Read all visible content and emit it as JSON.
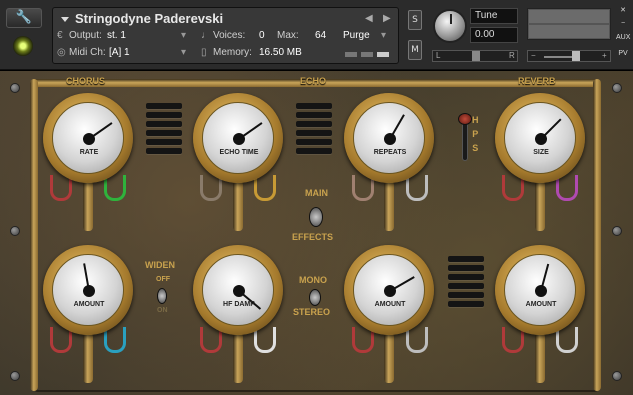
{
  "header": {
    "instrument_name": "Stringodyne Paderevski",
    "output_label": "Output:",
    "output_value": "st. 1",
    "voices_label": "Voices:",
    "voices_value": "0",
    "max_label": "Max:",
    "max_value": "64",
    "purge_label": "Purge",
    "midi_label": "Midi Ch:",
    "midi_value": "[A] 1",
    "memory_label": "Memory:",
    "memory_value": "16.50 MB",
    "s_label": "S",
    "m_label": "M",
    "tune_label": "Tune",
    "tune_value": "0.00",
    "pan_left": "L",
    "pan_right": "R",
    "vol_minus": "−",
    "vol_plus": "+",
    "side_close": "✕",
    "side_min": "−",
    "side_aux": "AUX",
    "side_pv": "PV"
  },
  "sections": {
    "chorus": "CHORUS",
    "echo": "ECHO",
    "reverb": "REVERB"
  },
  "gauges": {
    "rate": "RATE",
    "echo_time": "ECHO TIME",
    "repeats": "REPEATS",
    "size": "SIZE",
    "amount1": "AMOUNT",
    "hf_damp": "HF DAMP",
    "amount2": "AMOUNT",
    "amount3": "AMOUNT"
  },
  "switches": {
    "main": "MAIN",
    "effects": "EFFECTS",
    "widen": "WIDEN",
    "off": "OFF",
    "on": "ON",
    "mono": "MONO",
    "stereo": "STEREO",
    "hps": "H\nP\nS"
  },
  "colors": {
    "accent": "#c9a24e",
    "panel": "#3e382b"
  }
}
